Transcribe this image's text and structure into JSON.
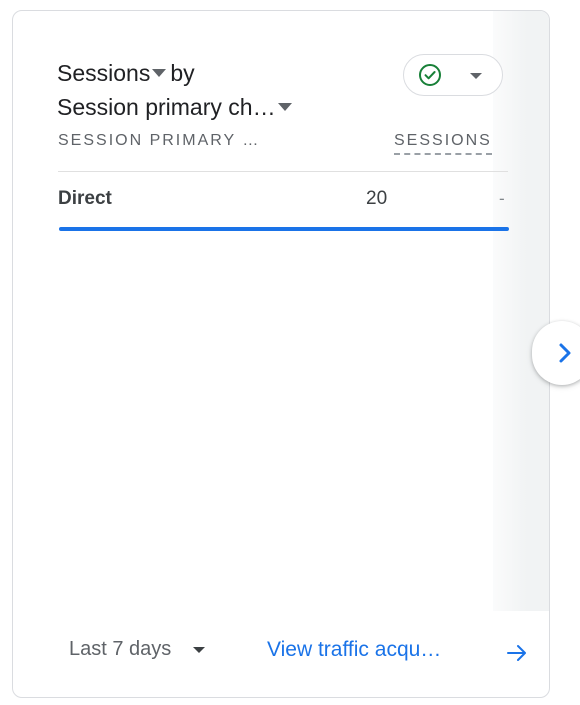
{
  "card": {
    "title_metric": "Sessions",
    "title_by": "by",
    "title_dimension": "Session primary ch…",
    "status_icon": "check-circle-icon",
    "status_color": "#188038"
  },
  "table": {
    "dimension_header": "SESSION PRIMARY …",
    "metric_header": "SESSIONS",
    "rows": [
      {
        "label": "Direct",
        "value": "20",
        "change": "-",
        "bar_fraction": 1.0
      }
    ]
  },
  "footer": {
    "date_range": "Last 7 days",
    "view_link": "View traffic acqu…",
    "link_color": "#1a73e8"
  },
  "navigation": {
    "next_icon": "chevron-right-icon"
  }
}
